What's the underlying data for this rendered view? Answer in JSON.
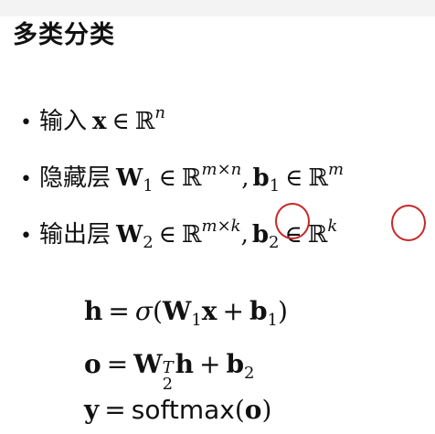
{
  "title": "多类分类",
  "bullets": {
    "input": {
      "label": "输入",
      "vec": "x",
      "in": "∈",
      "set": "ℝ",
      "dim": "n"
    },
    "hidden": {
      "label": "隐藏层",
      "W": "W",
      "Wsub": "1",
      "in": "∈",
      "set": "ℝ",
      "Wdim": "m×n",
      "comma": ",",
      "b": "b",
      "bsub": "1",
      "bdim": "m"
    },
    "output": {
      "label": "输出层",
      "W": "W",
      "Wsub": "2",
      "in": "∈",
      "set": "ℝ",
      "Wdim": "m×k",
      "comma": ",",
      "b": "b",
      "bsub": "2",
      "bdim": "k"
    }
  },
  "equations": {
    "h": {
      "lhs": "h",
      "eq": "=",
      "sigma": "σ",
      "lp": "(",
      "W": "W",
      "Wsub": "1",
      "x": "x",
      "plus": "+",
      "b": "b",
      "bsub": "1",
      "rp": ")"
    },
    "o": {
      "lhs": "o",
      "eq": "=",
      "W": "W",
      "Wsub": "2",
      "Wsup": "T",
      "h": "h",
      "plus": "+",
      "b": "b",
      "bsub": "2"
    },
    "y": {
      "lhs": "y",
      "eq": "=",
      "fn": "softmax",
      "lp": "(",
      "arg": "o",
      "rp": ")"
    }
  },
  "annotation_color": "#c62828"
}
